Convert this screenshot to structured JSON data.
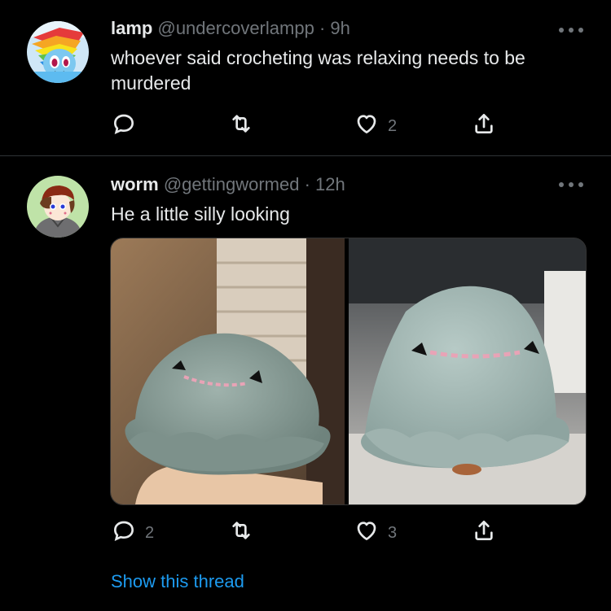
{
  "tweets": [
    {
      "name": "lamp",
      "handle": "@undercoverlampp",
      "dot": "·",
      "time": "9h",
      "text": "whoever said crocheting was relaxing needs to be murdered",
      "reply_count": "",
      "retweet_count": "",
      "like_count": "2"
    },
    {
      "name": "worm",
      "handle": "@gettingwormed",
      "dot": "·",
      "time": "12h",
      "text": "He a little silly looking",
      "reply_count": "2",
      "retweet_count": "",
      "like_count": "3",
      "show_thread": "Show this thread"
    }
  ],
  "colors": {
    "background": "#000000",
    "text": "#e7e9ea",
    "muted": "#71767b",
    "link": "#1d9bf0",
    "divider": "#2f3336"
  },
  "icons": [
    "reply-icon",
    "retweet-icon",
    "like-icon",
    "share-icon",
    "more-icon"
  ]
}
